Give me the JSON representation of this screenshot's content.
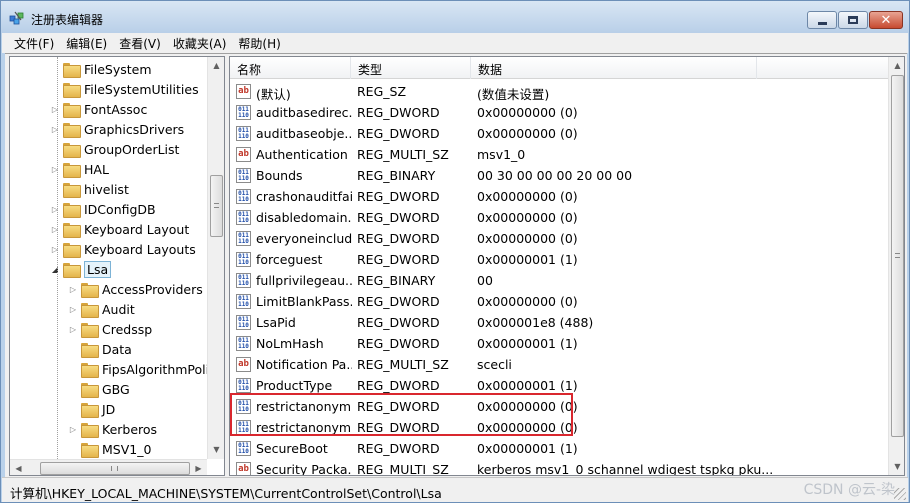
{
  "window": {
    "title": "注册表编辑器",
    "close_glyph": "✕"
  },
  "menu": [
    {
      "label": "文件(F)"
    },
    {
      "label": "编辑(E)"
    },
    {
      "label": "查看(V)"
    },
    {
      "label": "收藏夹(A)"
    },
    {
      "label": "帮助(H)"
    }
  ],
  "tree": {
    "items": [
      {
        "label": "FileSystem",
        "level": 1,
        "arrow": ""
      },
      {
        "label": "FileSystemUtilities",
        "level": 1,
        "arrow": ""
      },
      {
        "label": "FontAssoc",
        "level": 1,
        "arrow": "▷"
      },
      {
        "label": "GraphicsDrivers",
        "level": 1,
        "arrow": "▷"
      },
      {
        "label": "GroupOrderList",
        "level": 1,
        "arrow": ""
      },
      {
        "label": "HAL",
        "level": 1,
        "arrow": "▷"
      },
      {
        "label": "hivelist",
        "level": 1,
        "arrow": ""
      },
      {
        "label": "IDConfigDB",
        "level": 1,
        "arrow": "▷"
      },
      {
        "label": "Keyboard Layout",
        "level": 1,
        "arrow": "▷"
      },
      {
        "label": "Keyboard Layouts",
        "level": 1,
        "arrow": "▷"
      },
      {
        "label": "Lsa",
        "level": 1,
        "arrow": "◢",
        "selected": true
      },
      {
        "label": "AccessProviders",
        "level": 2,
        "arrow": "▷"
      },
      {
        "label": "Audit",
        "level": 2,
        "arrow": "▷"
      },
      {
        "label": "Credssp",
        "level": 2,
        "arrow": "▷"
      },
      {
        "label": "Data",
        "level": 2,
        "arrow": ""
      },
      {
        "label": "FipsAlgorithmPoli",
        "level": 2,
        "arrow": ""
      },
      {
        "label": "GBG",
        "level": 2,
        "arrow": ""
      },
      {
        "label": "JD",
        "level": 2,
        "arrow": ""
      },
      {
        "label": "Kerberos",
        "level": 2,
        "arrow": "▷"
      },
      {
        "label": "MSV1_0",
        "level": 2,
        "arrow": ""
      }
    ],
    "scroll_up": "▲",
    "scroll_down": "▼",
    "scroll_left": "◀",
    "scroll_right": "▶"
  },
  "list": {
    "columns": [
      "名称",
      "类型",
      "数据"
    ],
    "rows": [
      {
        "icon": "string-value-icon",
        "name": "(默认)",
        "type": "REG_SZ",
        "data": "(数值未设置)"
      },
      {
        "icon": "binary-value-icon",
        "name": "auditbasedirec...",
        "type": "REG_DWORD",
        "data": "0x00000000 (0)"
      },
      {
        "icon": "binary-value-icon",
        "name": "auditbaseobje...",
        "type": "REG_DWORD",
        "data": "0x00000000 (0)"
      },
      {
        "icon": "string-value-icon",
        "name": "Authentication ...",
        "type": "REG_MULTI_SZ",
        "data": "msv1_0"
      },
      {
        "icon": "binary-value-icon",
        "name": "Bounds",
        "type": "REG_BINARY",
        "data": "00 30 00 00 00 20 00 00"
      },
      {
        "icon": "binary-value-icon",
        "name": "crashonauditfail",
        "type": "REG_DWORD",
        "data": "0x00000000 (0)"
      },
      {
        "icon": "binary-value-icon",
        "name": "disabledomain...",
        "type": "REG_DWORD",
        "data": "0x00000000 (0)"
      },
      {
        "icon": "binary-value-icon",
        "name": "everyoneinclud...",
        "type": "REG_DWORD",
        "data": "0x00000000 (0)"
      },
      {
        "icon": "binary-value-icon",
        "name": "forceguest",
        "type": "REG_DWORD",
        "data": "0x00000001 (1)"
      },
      {
        "icon": "binary-value-icon",
        "name": "fullprivilegeau...",
        "type": "REG_BINARY",
        "data": "00"
      },
      {
        "icon": "binary-value-icon",
        "name": "LimitBlankPass...",
        "type": "REG_DWORD",
        "data": "0x00000000 (0)"
      },
      {
        "icon": "binary-value-icon",
        "name": "LsaPid",
        "type": "REG_DWORD",
        "data": "0x000001e8 (488)"
      },
      {
        "icon": "binary-value-icon",
        "name": "NoLmHash",
        "type": "REG_DWORD",
        "data": "0x00000001 (1)"
      },
      {
        "icon": "string-value-icon",
        "name": "Notification Pa...",
        "type": "REG_MULTI_SZ",
        "data": "scecli"
      },
      {
        "icon": "binary-value-icon",
        "name": "ProductType",
        "type": "REG_DWORD",
        "data": "0x00000001 (1)"
      },
      {
        "icon": "binary-value-icon",
        "name": "restrictanonym...",
        "type": "REG_DWORD",
        "data": "0x00000000 (0)"
      },
      {
        "icon": "binary-value-icon",
        "name": "restrictanonym...",
        "type": "REG_DWORD",
        "data": "0x00000000 (0)"
      },
      {
        "icon": "binary-value-icon",
        "name": "SecureBoot",
        "type": "REG_DWORD",
        "data": "0x00000001 (1)"
      },
      {
        "icon": "string-value-icon",
        "name": "Security Packa...",
        "type": "REG_MULTI_SZ",
        "data": "kerberos msv1_0 schannel wdigest tspkg pku..."
      }
    ],
    "scroll_up": "▲",
    "scroll_down": "▼"
  },
  "icons": {
    "string_glyph": "ab",
    "binary_glyph": "011 110"
  },
  "highlight_color": "#d9272e",
  "status": {
    "path": "计算机\\HKEY_LOCAL_MACHINE\\SYSTEM\\CurrentControlSet\\Control\\Lsa"
  },
  "watermark": "CSDN @云-染"
}
